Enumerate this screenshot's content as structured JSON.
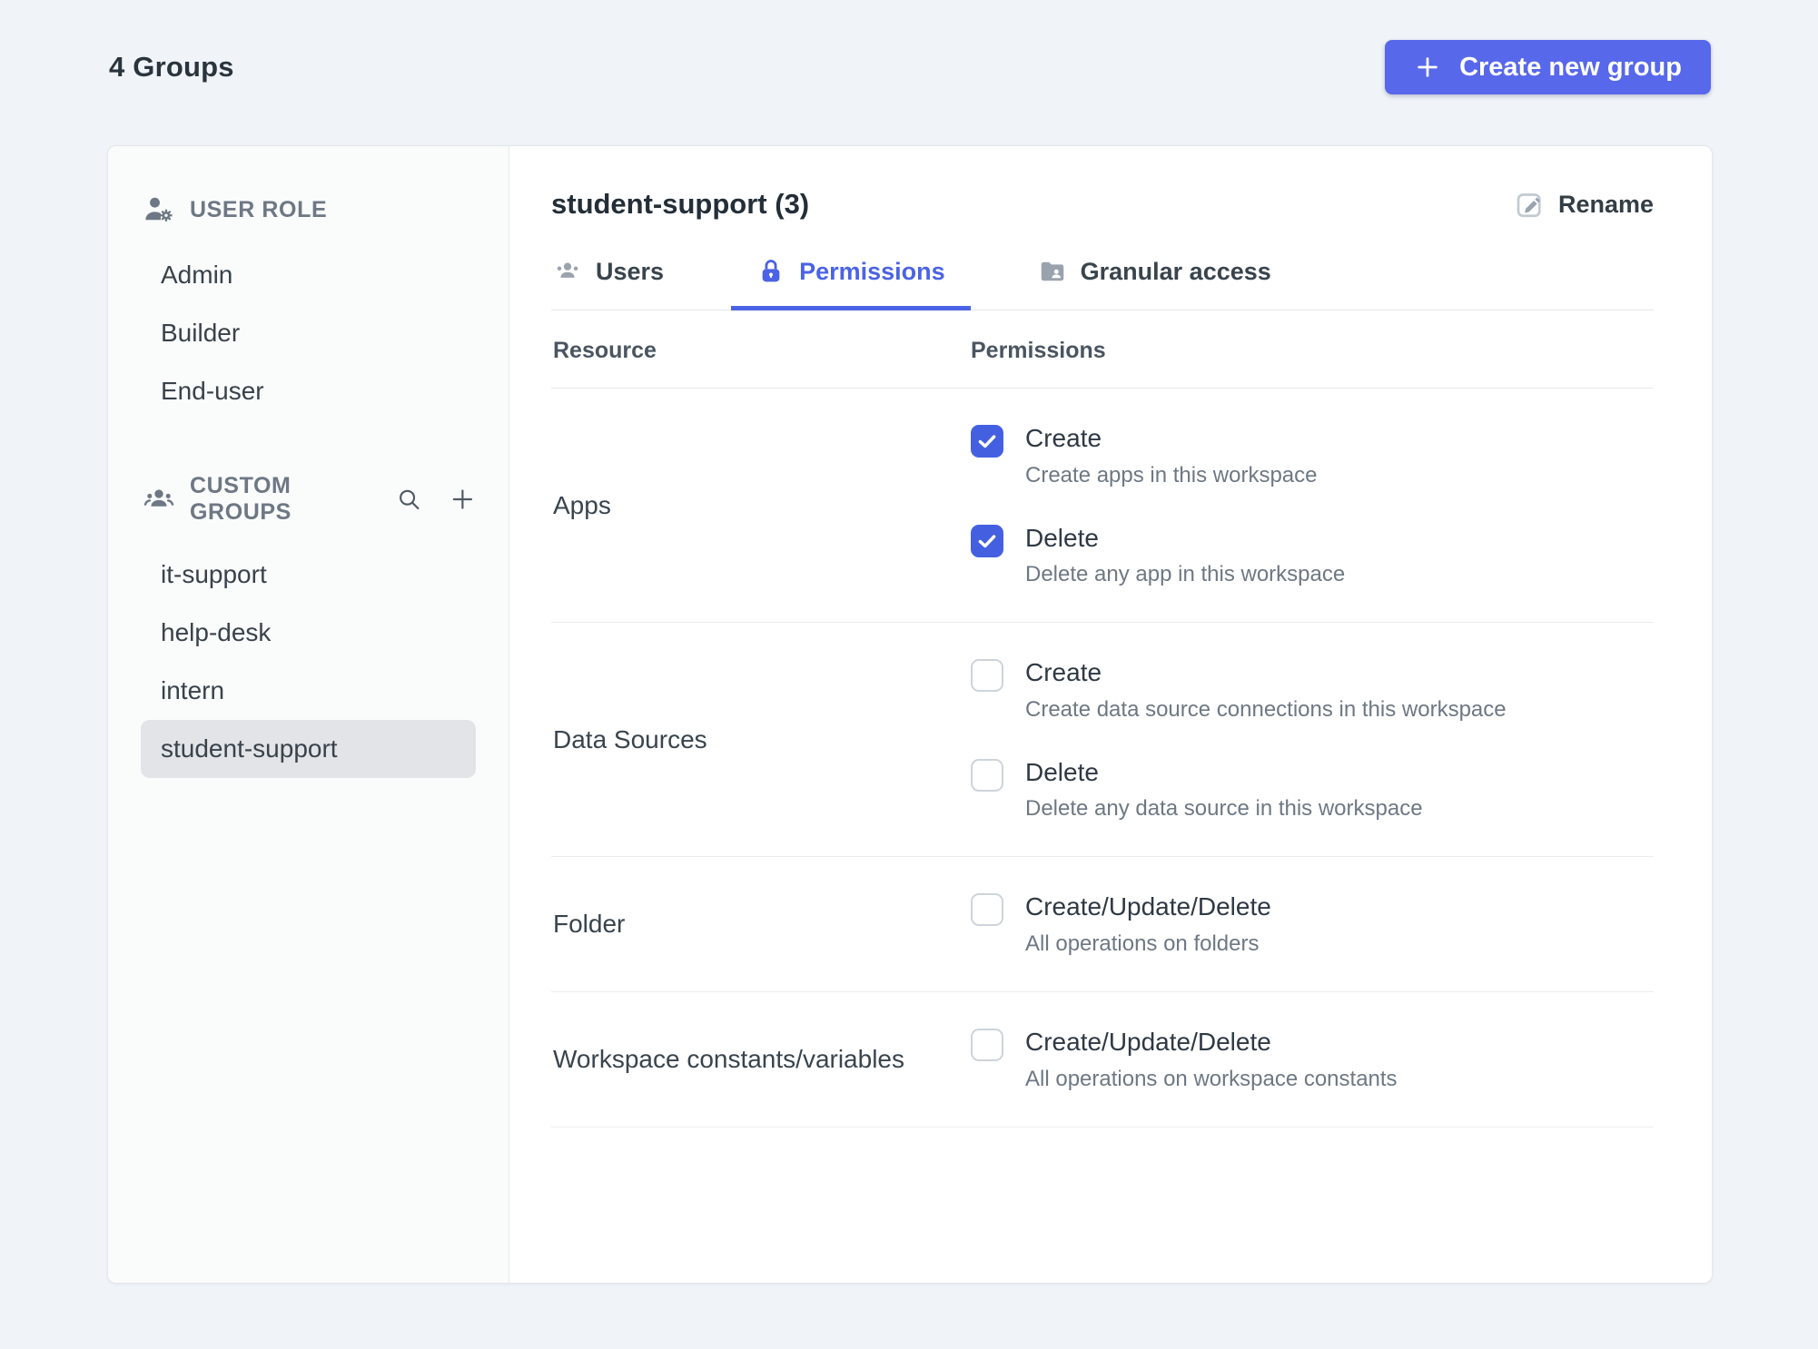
{
  "page": {
    "heading": "4 Groups"
  },
  "colors": {
    "accent": "#4B63E4",
    "button_blue": "#5768EA",
    "checkbox_blue": "#4460E1"
  },
  "create_button": {
    "label": "Create new group",
    "icon": "plus-icon"
  },
  "sidebar": {
    "sections": [
      {
        "title": "USER ROLE",
        "icon": "user-role-icon",
        "items": [
          {
            "label": "Admin"
          },
          {
            "label": "Builder"
          },
          {
            "label": "End-user"
          }
        ]
      },
      {
        "title": "CUSTOM GROUPS",
        "icon": "people-group-icon",
        "actions": [
          "search-icon",
          "plus-icon"
        ],
        "items": [
          {
            "label": "it-support"
          },
          {
            "label": "help-desk"
          },
          {
            "label": "intern"
          },
          {
            "label": "student-support",
            "selected": true
          }
        ]
      }
    ]
  },
  "main": {
    "title": "student-support (3)",
    "rename_label": "Rename",
    "tabs": [
      {
        "label": "Users",
        "icon": "users-icon",
        "active": false
      },
      {
        "label": "Permissions",
        "icon": "lock-icon",
        "active": true
      },
      {
        "label": "Granular access",
        "icon": "folder-user-icon",
        "active": false
      }
    ],
    "table": {
      "columns": [
        "Resource",
        "Permissions"
      ],
      "rows": [
        {
          "resource": "Apps",
          "permissions": [
            {
              "label": "Create",
              "description": "Create apps in this workspace",
              "checked": true
            },
            {
              "label": "Delete",
              "description": "Delete any app in this workspace",
              "checked": true
            }
          ]
        },
        {
          "resource": "Data Sources",
          "permissions": [
            {
              "label": "Create",
              "description": "Create data source connections in this workspace",
              "checked": false
            },
            {
              "label": "Delete",
              "description": "Delete any data source in this workspace",
              "checked": false
            }
          ]
        },
        {
          "resource": "Folder",
          "permissions": [
            {
              "label": "Create/Update/Delete",
              "description": "All operations on folders",
              "checked": false
            }
          ]
        },
        {
          "resource": "Workspace constants/variables",
          "permissions": [
            {
              "label": "Create/Update/Delete",
              "description": "All operations on workspace constants",
              "checked": false
            }
          ]
        }
      ]
    }
  }
}
